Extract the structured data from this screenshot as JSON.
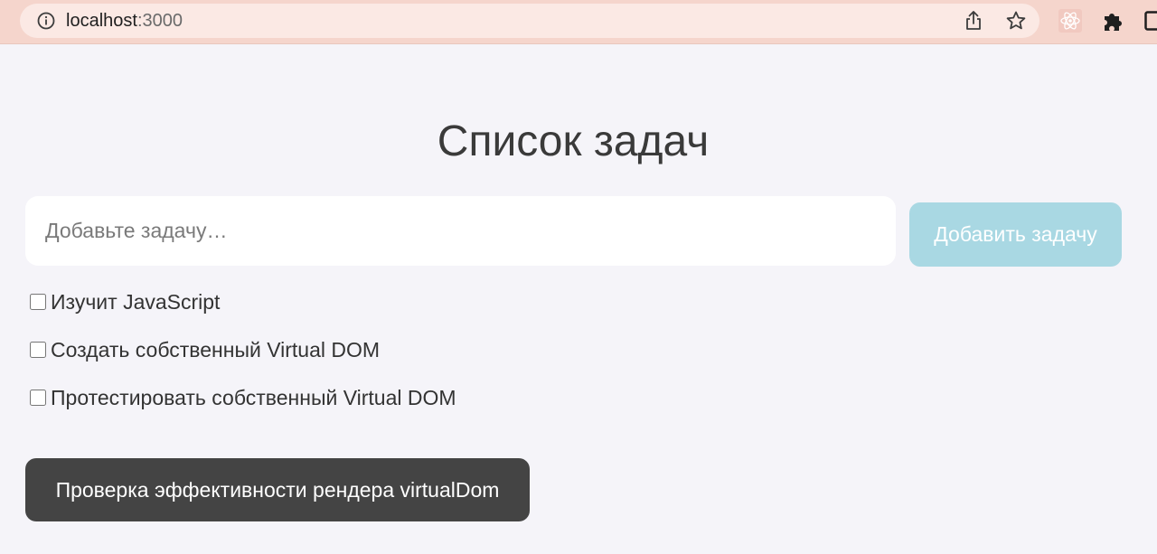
{
  "browser": {
    "url_host": "localhost",
    "url_port": ":3000",
    "icons": [
      "info-icon",
      "share-icon",
      "star-icon",
      "react-extension-icon",
      "puzzle-icon",
      "window-icon"
    ]
  },
  "app": {
    "title": "Список задач",
    "input_placeholder": "Добавьте задачу…",
    "add_button_label": "Добавить задачу",
    "tasks": [
      {
        "label": "Изучит JavaScript",
        "checked": false
      },
      {
        "label": "Создать собственный Virtual DOM",
        "checked": false
      },
      {
        "label": "Протестировать собственный Virtual DOM",
        "checked": false
      }
    ],
    "perf_button_label": "Проверка эффективности рендера virtualDom"
  },
  "colors": {
    "chrome_bar": "#f5d5cc",
    "page_background": "#f5f4f9",
    "add_button": "#a9d8e3",
    "perf_button": "#444444"
  }
}
